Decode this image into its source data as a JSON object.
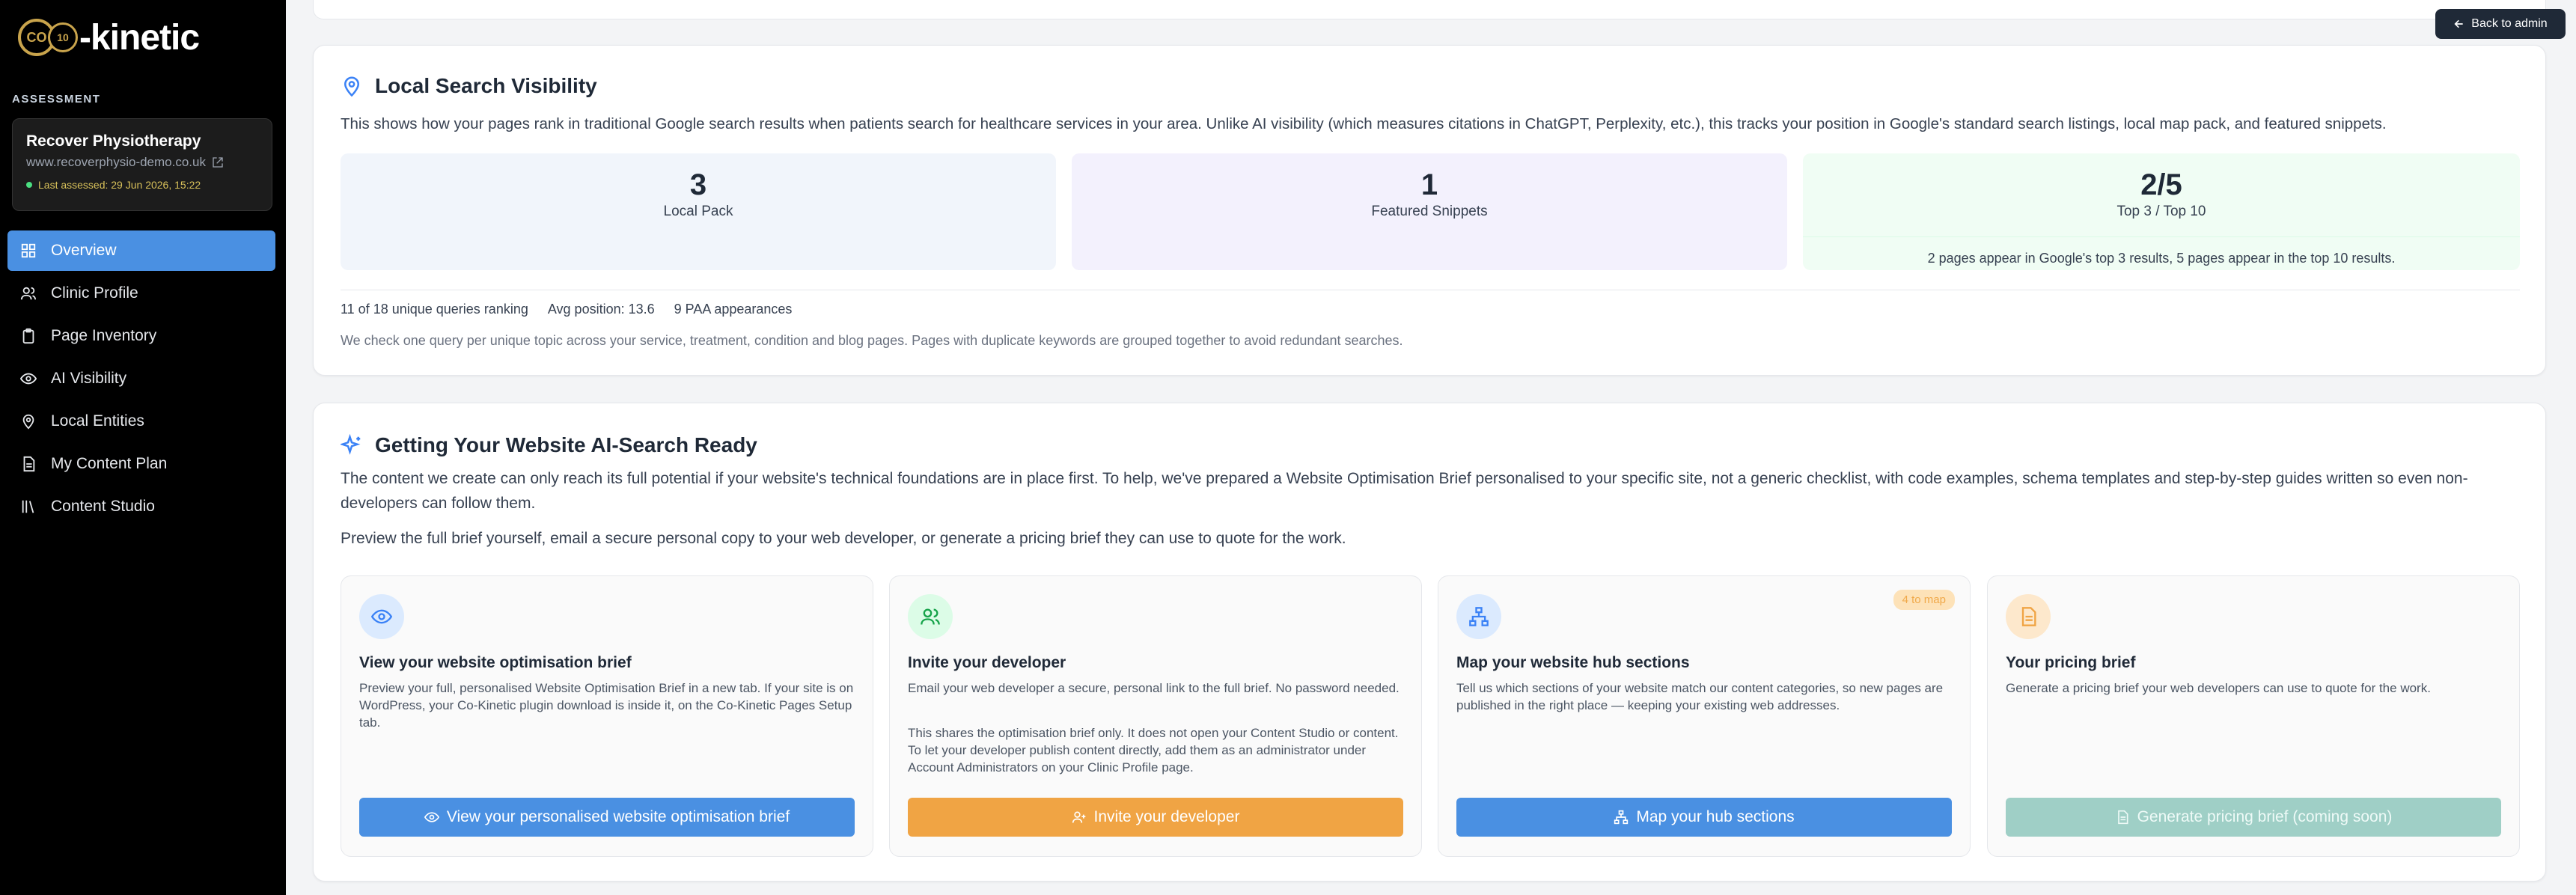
{
  "brand": {
    "logo_badge": "CO",
    "logo_badge2": "10",
    "logo_text": "-kinetic"
  },
  "sidebar": {
    "section_label": "ASSESSMENT",
    "clinic": {
      "name": "Recover Physiotherapy",
      "url": "www.recoverphysio-demo.co.uk",
      "assessed": "Last assessed: 29 Jun 2026, 15:22"
    },
    "items": [
      {
        "label": "Overview",
        "icon": "grid-icon",
        "active": true
      },
      {
        "label": "Clinic Profile",
        "icon": "users-icon"
      },
      {
        "label": "Page Inventory",
        "icon": "clipboard-icon"
      },
      {
        "label": "AI Visibility",
        "icon": "eye-icon"
      },
      {
        "label": "Local Entities",
        "icon": "map-pin-icon"
      },
      {
        "label": "My Content Plan",
        "icon": "document-icon"
      },
      {
        "label": "Content Studio",
        "icon": "library-icon"
      }
    ]
  },
  "header": {
    "back_label": "Back to admin"
  },
  "local_search": {
    "title": "Local Search Visibility",
    "description": "This shows how your pages rank in traditional Google search results when patients search for healthcare services in your area. Unlike AI visibility (which measures citations in ChatGPT, Perplexity, etc.), this tracks your position in Google's standard search listings, local map pack, and featured snippets.",
    "stats": [
      {
        "value": "3",
        "label": "Local Pack",
        "color": "#f1f5fb"
      },
      {
        "value": "1",
        "label": "Featured Snippets",
        "color": "#f3f1fd"
      },
      {
        "value": "2/5",
        "label": "Top 3 / Top 10",
        "note": "2 pages appear in Google's top 3 results, 5 pages appear in the top 10 results.",
        "color": "#f0fdf4"
      }
    ],
    "meta": {
      "queries": "11 of 18 unique queries ranking",
      "avg_position": "Avg position: 13.6",
      "paa": "9 PAA appearances"
    },
    "note": "We check one query per unique topic across your service, treatment, condition and blog pages. Pages with duplicate keywords are grouped together to avoid redundant searches."
  },
  "ai_ready": {
    "title": "Getting Your Website AI-Search Ready",
    "paragraph1": "The content we create can only reach its full potential if your website's technical foundations are in place first. To help, we've prepared a Website Optimisation Brief personalised to your specific site, not a generic checklist, with code examples, schema templates and step-by-step guides written so even non-developers can follow them.",
    "paragraph2": "Preview the full brief yourself, email a secure personal copy to your web developer, or generate a pricing brief they can use to quote for the work.",
    "options": [
      {
        "title": "View your website optimisation brief",
        "text": "Preview your full, personalised Website Optimisation Brief in a new tab. If your site is on WordPress, your Co-Kinetic plugin download is inside it, on the Co-Kinetic Pages Setup tab.",
        "text2": "",
        "button": "View your personalised website optimisation brief",
        "icon": "eye-icon",
        "icon_bg": "#dbeafe",
        "icon_color": "#3b82f6",
        "button_color": "#4a90e2"
      },
      {
        "title": "Invite your developer",
        "text": "Email your web developer a secure, personal link to the full brief. No password needed.",
        "text2": "This shares the optimisation brief only. It does not open your Content Studio or content. To let your developer publish content directly, add them as an administrator under Account Administrators on your Clinic Profile page.",
        "button": "Invite your developer",
        "icon": "users-icon",
        "icon_bg": "#dcfce7",
        "icon_color": "#16a34a",
        "button_color": "#f0a444"
      },
      {
        "title": "Map your website hub sections",
        "text": "Tell us which sections of your website match our content categories, so new pages are published in the right place — keeping your existing web addresses.",
        "text2": "",
        "button": "Map your hub sections",
        "badge": "4 to map",
        "icon": "sitemap-icon",
        "icon_bg": "#dbeafe",
        "icon_color": "#3b82f6",
        "button_color": "#4a90e2"
      },
      {
        "title": "Your pricing brief",
        "text": "Generate a pricing brief your web developers can use to quote for the work.",
        "text2": "",
        "button": "Generate pricing brief (coming soon)",
        "icon": "document-icon",
        "icon_bg": "#fde8cc",
        "icon_color": "#f0a444",
        "button_color": "#9fcfc6"
      }
    ]
  }
}
